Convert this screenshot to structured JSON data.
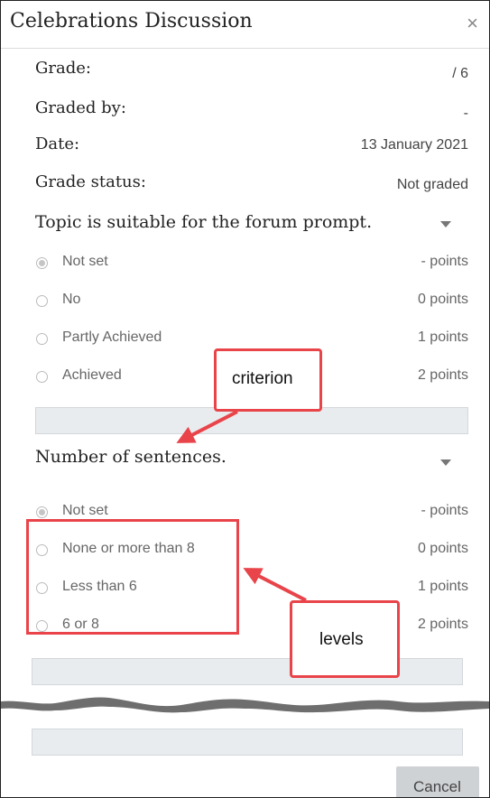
{
  "dialog": {
    "title": "Celebrations Discussion",
    "close_glyph": "×"
  },
  "summary": [
    {
      "label": "Grade:",
      "value": "/ 6"
    },
    {
      "label": "Graded by:",
      "value": "-"
    },
    {
      "label": "Date:",
      "value": "13 January 2021"
    },
    {
      "label": "Grade status:",
      "value": "Not graded"
    }
  ],
  "criteria": [
    {
      "name": "Topic is suitable for the forum prompt.",
      "levels": [
        {
          "label": "Not set",
          "points": "- points",
          "selected": true
        },
        {
          "label": "No",
          "points": "0 points",
          "selected": false
        },
        {
          "label": "Partly Achieved",
          "points": "1 points",
          "selected": false
        },
        {
          "label": "Achieved",
          "points": "2 points",
          "selected": false
        }
      ]
    },
    {
      "name": "Number of sentences.",
      "levels": [
        {
          "label": "Not set",
          "points": "- points",
          "selected": true
        },
        {
          "label": "None or more than 8",
          "points": "0 points",
          "selected": false
        },
        {
          "label": "Less than 6",
          "points": "1 points",
          "selected": false
        },
        {
          "label": "6 or 8",
          "points": "2 points",
          "selected": false
        }
      ]
    }
  ],
  "annotations": {
    "criterion_label": "criterion",
    "levels_label": "levels",
    "color": "#e8444a"
  },
  "footer": {
    "cancel_label": "Cancel"
  }
}
